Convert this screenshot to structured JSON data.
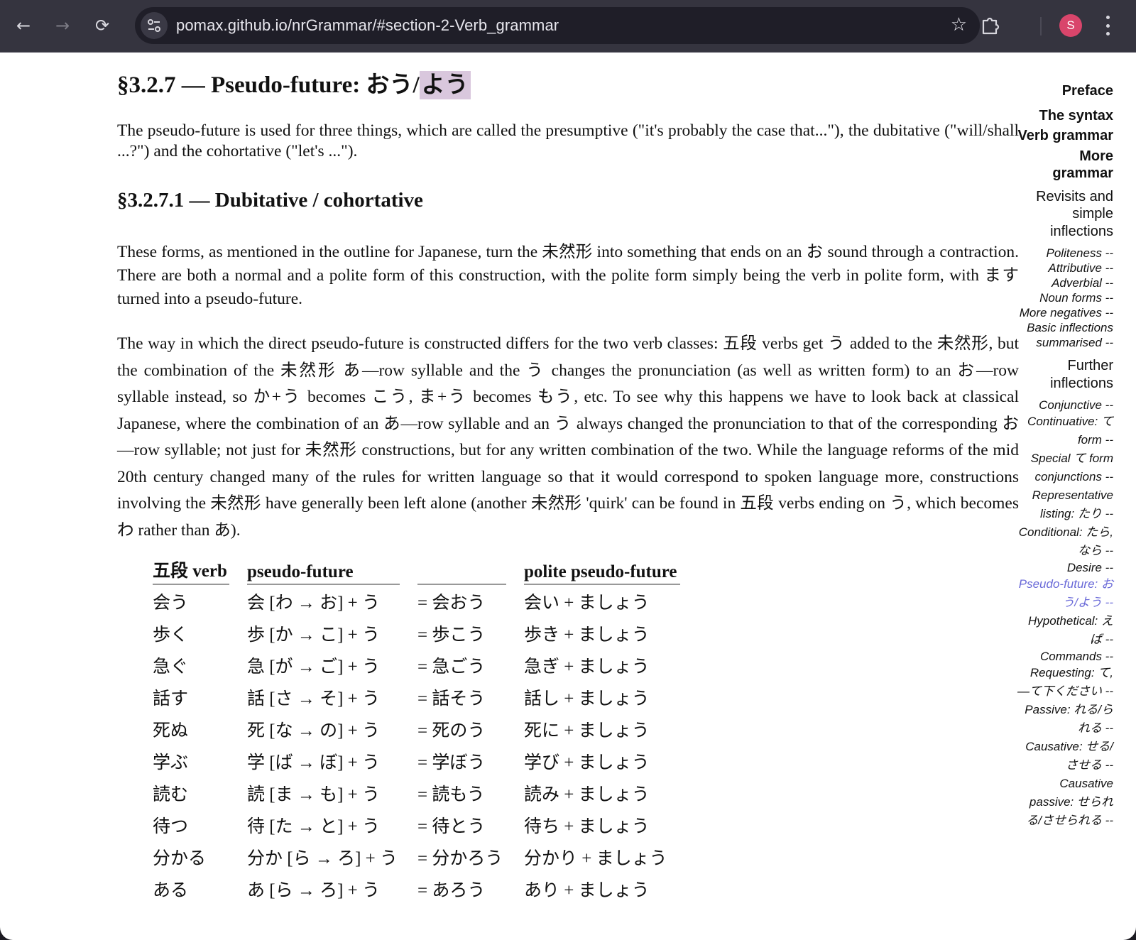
{
  "browser": {
    "url": "pomax.github.io/nrGrammar/#section-2-Verb_grammar",
    "avatar_initial": "S",
    "icons": {
      "back": "←",
      "forward": "→",
      "reload": "⟳",
      "star": "☆",
      "extensions": "⧉"
    }
  },
  "article": {
    "section_heading_prefix": "§3.2.7 — Pseudo-future: おう/",
    "section_heading_highlight": "よう",
    "intro": "The pseudo-future is used for three things, which are called the presumptive (\"it's probably the case that...\"), the dubitative (\"will/shall ...?\") and the cohortative (\"let's ...\").",
    "subsection_heading": "§3.2.7.1 — Dubitative / cohortative",
    "paragraph_forms": "These forms, as mentioned in the outline for Japanese, turn the 未然形 into something that ends on an お sound through a contraction. There are both a normal and a polite form of this construction, with the polite form simply being the verb in polite form, with ます turned into a pseudo-future.",
    "paragraph_construction": "The way in which the direct pseudo-future is constructed differs for the two verb classes: 五段 verbs get う added to the 未然形, but the combination of the 未然形 あ—row syllable and the う changes the pronunciation (as well as written form) to an お—row syllable instead, so か+う becomes こう, ま+う becomes もう, etc. To see why this happens we have to look back at classical Japanese, where the combination of an あ—row syllable and an う always changed the pronunciation to that of the corresponding お—row syllable; not just for 未然形 constructions, but for any written combination of the two. While the language reforms of the mid 20th century changed many of the rules for written language so that it would correspond to spoken language more, constructions involving the 未然形 have generally been left alone (another 未然形 'quirk' can be found in 五段 verbs ending on う, which becomes わ rather than あ).",
    "table": {
      "headers": [
        "五段 verb",
        "pseudo-future",
        "",
        "polite pseudo-future"
      ],
      "rows": [
        [
          "会う",
          "会 [わ → お] + う",
          "= 会おう",
          "会い + ましょう"
        ],
        [
          "歩く",
          "歩 [か → こ] + う",
          "= 歩こう",
          "歩き + ましょう"
        ],
        [
          "急ぐ",
          "急 [が → ご] + う",
          "= 急ごう",
          "急ぎ + ましょう"
        ],
        [
          "話す",
          "話 [さ → そ] + う",
          "= 話そう",
          "話し + ましょう"
        ],
        [
          "死ぬ",
          "死 [な → の] + う",
          "= 死のう",
          "死に + ましょう"
        ],
        [
          "学ぶ",
          "学 [ば → ぼ] + う",
          "= 学ぼう",
          "学び + ましょう"
        ],
        [
          "読む",
          "読 [ま → も] + う",
          "= 読もう",
          "読み + ましょう"
        ],
        [
          "待つ",
          "待 [た → と] + う",
          "= 待とう",
          "待ち + ましょう"
        ],
        [
          "分かる",
          "分か [ら → ろ] + う",
          "= 分かろう",
          "分かり + ましょう"
        ],
        [
          "ある",
          "あ [ら → ろ] + う",
          "= あろう",
          "あり + ましょう"
        ]
      ]
    }
  },
  "toc": {
    "chapters": [
      "Preface",
      "The syntax",
      "Verb grammar",
      "More grammar"
    ],
    "part_revisits": "Revisits and simple inflections",
    "revisits_items": [
      "Politeness --",
      "Attributive --",
      "Adverbial --",
      "Noun forms --",
      "More negatives --",
      "Basic inflections summarised --"
    ],
    "part_further": "Further inflections",
    "further_items": [
      "Conjunctive --",
      "Continuative: て form --",
      "Special て form conjunctions --",
      "Representative listing: たり --",
      "Conditional: たら, なら --",
      "Desire --",
      "Pseudo-future: おう/よう --",
      "Hypothetical: えば --",
      "Commands --",
      "Requesting: て, —て下ください --",
      "Passive: れる/られる --",
      "Causative: せる/させる --",
      "Causative passive: せられる/させられる --"
    ],
    "active_item": "Pseudo-future: おう/よう --",
    "active_color": "#6a6ad8"
  }
}
